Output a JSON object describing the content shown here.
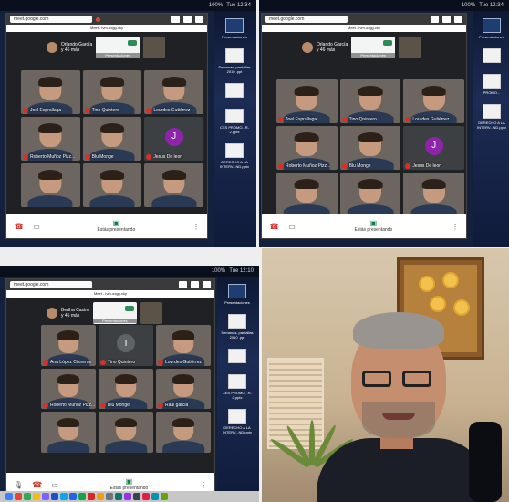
{
  "colors": {
    "mic_off": "#d93025",
    "meet_green": "#0b8043",
    "wallpaper": "#14213d"
  },
  "panels": [
    {
      "status": {
        "time": "Tue 12:34",
        "battery": "100%"
      },
      "url": "meet.google.com",
      "meet_title": "Meet - lvm-oxgg-vky",
      "presenter": {
        "name": "Orlando García",
        "more": "y 46 más",
        "cap": "Presentaciones"
      },
      "tiles": [
        {
          "name": "Joel Esprallaga",
          "kind": "person"
        },
        {
          "name": "Tino Quintero",
          "kind": "person"
        },
        {
          "name": "Lourdes Gutiérrez",
          "kind": "person"
        },
        {
          "name": "Roberto Muñoz Pizz...",
          "kind": "person"
        },
        {
          "name": "Blu Monge",
          "kind": "person"
        },
        {
          "name": "Jesus De leon",
          "kind": "letter",
          "letter": "J",
          "color": "#8e24aa"
        },
        {
          "name": "",
          "kind": "person"
        },
        {
          "name": "",
          "kind": "person"
        },
        {
          "name": "",
          "kind": "person"
        }
      ],
      "controls": {
        "present": "Estás presentando"
      },
      "desktop": [
        {
          "label": "Presentaciones",
          "style": "blue"
        },
        {
          "label": "Semanas, pantallas 2010 .ppt",
          "style": "pdf"
        },
        {
          "label": "",
          "style": "pdf"
        },
        {
          "label": "CES PROMO...R-2.pptx",
          "style": "pdf"
        },
        {
          "label": "DERECHO A LA INTERV...ND.pptx",
          "style": "pdf"
        }
      ]
    },
    {
      "status": {
        "time": "Tue 12:34",
        "battery": "100%"
      },
      "url": "meet.google.com",
      "meet_title": "Meet - lvm-oxgg-vky",
      "presenter": {
        "name": "Orlando García",
        "more": "y 46 más",
        "cap": "Presentaciones"
      },
      "tiles": [
        {
          "name": "Joel Esprallaga",
          "kind": "person"
        },
        {
          "name": "Tino Quintero",
          "kind": "person"
        },
        {
          "name": "Lourdes Gutiérrez",
          "kind": "person"
        },
        {
          "name": "Roberto Muñoz Pizz...",
          "kind": "person"
        },
        {
          "name": "Blu Monge",
          "kind": "person"
        },
        {
          "name": "Jesus De leon",
          "kind": "letter",
          "letter": "J",
          "color": "#8e24aa"
        },
        {
          "name": "",
          "kind": "person"
        },
        {
          "name": "",
          "kind": "person"
        },
        {
          "name": "",
          "kind": "person"
        }
      ],
      "controls": {
        "present": "Estás presentando"
      },
      "desktop": [
        {
          "label": "Presentaciones",
          "style": "blue"
        },
        {
          "label": "",
          "style": "pdf"
        },
        {
          "label": "PROMO...",
          "style": "pdf"
        },
        {
          "label": "DERECHO A LA INTERV...ND.pptx",
          "style": "pdf"
        }
      ]
    },
    {
      "status": {
        "time": "Tue 12:10",
        "battery": "100%"
      },
      "url": "meet.google.com",
      "meet_title": "Meet - lvm-oxgg-vky",
      "presenter": {
        "name": "Bertha Castro",
        "more": "y 46 más",
        "cap": "Presentaciones"
      },
      "tiles": [
        {
          "name": "Ana López Cisneros",
          "kind": "person"
        },
        {
          "name": "Tino Quintero",
          "kind": "letter",
          "letter": "T",
          "color": "#5f6368"
        },
        {
          "name": "Lourdes Gutiérrez",
          "kind": "person"
        },
        {
          "name": "Roberto Muñoz Pizz...",
          "kind": "person"
        },
        {
          "name": "Blu Monge",
          "kind": "person"
        },
        {
          "name": "Raul garcia",
          "kind": "person"
        },
        {
          "name": "",
          "kind": "person"
        },
        {
          "name": "",
          "kind": "person"
        },
        {
          "name": "",
          "kind": "person"
        }
      ],
      "controls": {
        "present": "Estás presentando"
      },
      "desktop": [
        {
          "label": "Presentaciones",
          "style": "blue"
        },
        {
          "label": "Semanas, pantallas 2010 .ppt",
          "style": "pdf"
        },
        {
          "label": "",
          "style": "pdf"
        },
        {
          "label": "CES PROMO...R-2.pptx",
          "style": "pdf"
        },
        {
          "label": "DERECHO A LA INTERV...ND.pptx",
          "style": "pdf"
        }
      ]
    }
  ]
}
